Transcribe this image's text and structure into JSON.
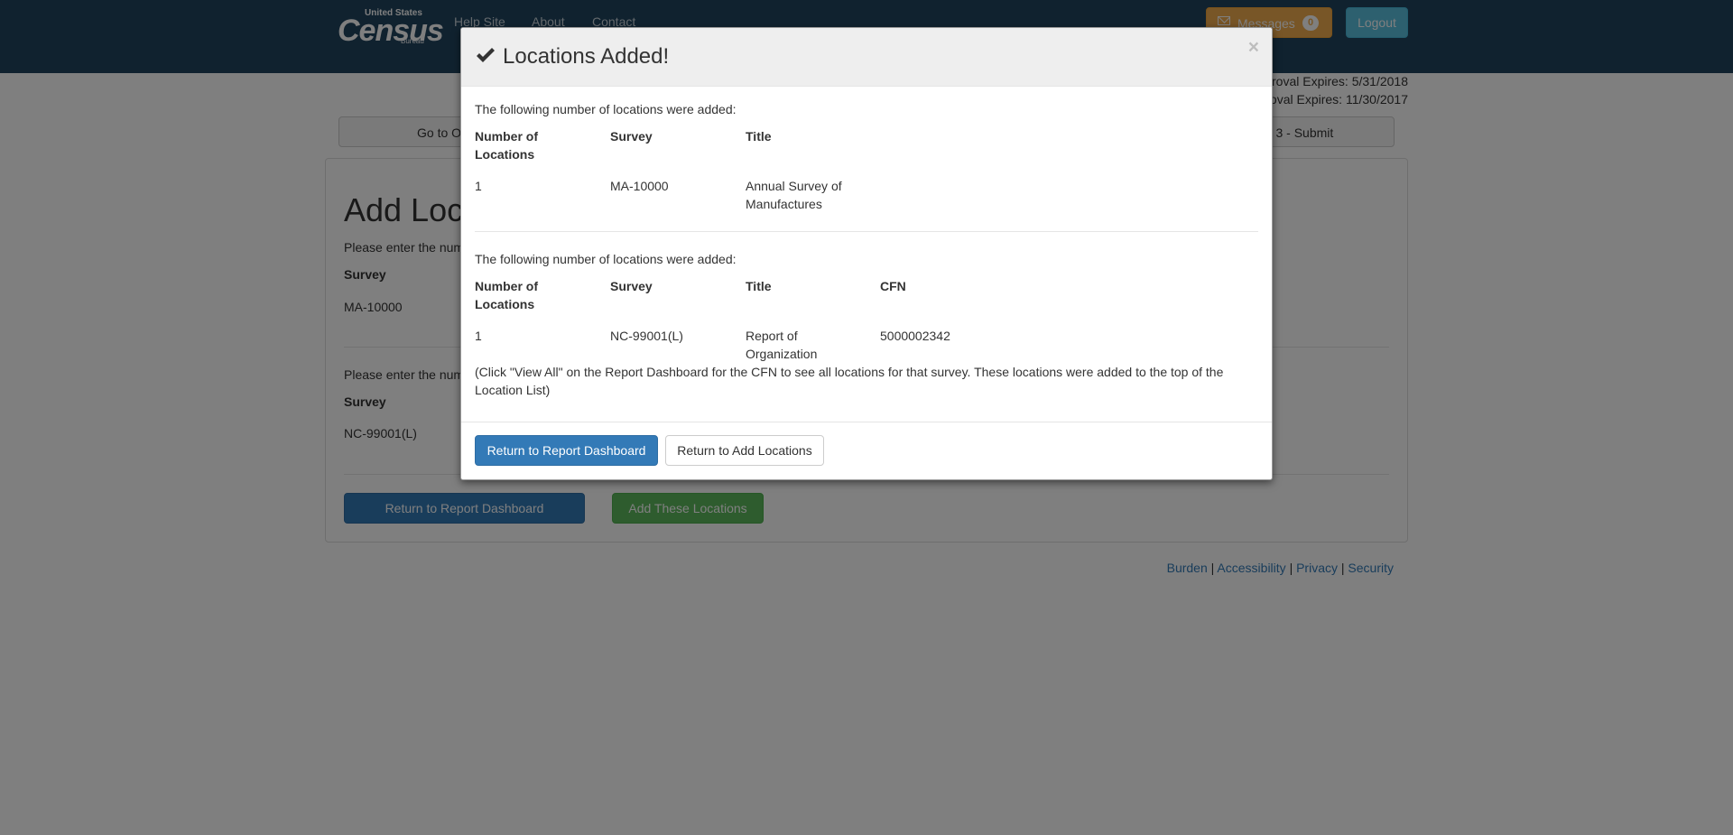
{
  "navbar": {
    "logo": {
      "line1": "United States",
      "line2": "Census",
      "line3": "Bureau"
    },
    "links": [
      "Help Site",
      "About",
      "Contact"
    ],
    "messages_label": "Messages",
    "messages_count": "0",
    "logout_label": "Logout"
  },
  "approval": {
    "line1": "roval Expires: 5/31/2018",
    "line2": "oval Expires: 11/30/2017"
  },
  "steps": {
    "left_text": "Go to O",
    "right_text": "ep 3 - Submit"
  },
  "page": {
    "title": "Add Loc",
    "section1_intro": "Please enter the num",
    "section1_survey_label": "Survey",
    "section1_survey_value": "MA-10000",
    "section2_intro": "Please enter the num",
    "section2_survey_label": "Survey",
    "section2_survey_value": "NC-99001(L)",
    "return_button": "Return to Report Dashboard",
    "add_button": "Add These Locations"
  },
  "footer": {
    "links": [
      "Burden",
      "Accessibility",
      "Privacy",
      "Security"
    ],
    "separator": "|"
  },
  "modal": {
    "title": "Locations Added!",
    "close": "×",
    "group1": {
      "intro": "The following number of locations were added:",
      "headers": {
        "num_line1": "Number of",
        "num_line2": "Locations",
        "survey": "Survey",
        "title": "Title"
      },
      "row": {
        "num": "1",
        "survey": "MA-10000",
        "title_line1": "Annual Survey of",
        "title_line2": "Manufactures"
      }
    },
    "group2": {
      "intro": "The following number of locations were added:",
      "headers": {
        "num_line1": "Number of",
        "num_line2": "Locations",
        "survey": "Survey",
        "title": "Title",
        "cfn": "CFN"
      },
      "row": {
        "num": "1",
        "survey": "NC-99001(L)",
        "title_line1": "Report of",
        "title_line2": "Organization",
        "cfn": "5000002342"
      },
      "note_line1": "(Click \"View All\" on the Report Dashboard for the CFN to see all locations for that survey. These locations were added to the top of the",
      "note_line2": "Location List)"
    },
    "buttons": {
      "primary": "Return to Report Dashboard",
      "secondary": "Return to Add Locations"
    }
  },
  "colors": {
    "navbar": "#21455f",
    "primary": "#337ab7",
    "success": "#5cb85c",
    "warning": "#f0ad4e",
    "info": "#5bc0de"
  }
}
